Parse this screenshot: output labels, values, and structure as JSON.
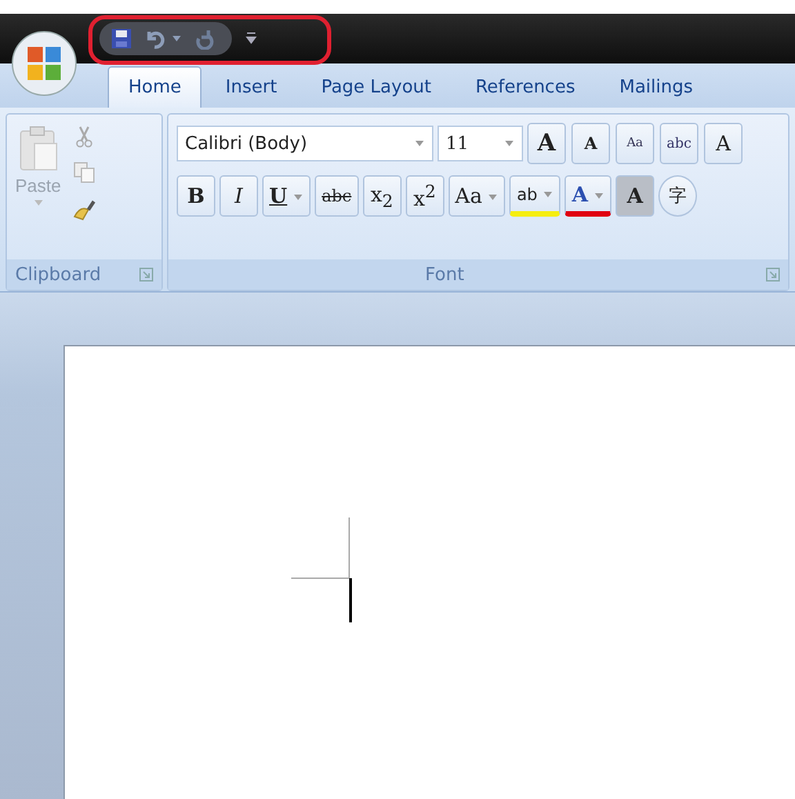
{
  "tabs": [
    {
      "label": "Home",
      "selected": true
    },
    {
      "label": "Insert",
      "selected": false
    },
    {
      "label": "Page Layout",
      "selected": false
    },
    {
      "label": "References",
      "selected": false
    },
    {
      "label": "Mailings",
      "selected": false
    }
  ],
  "clipboard": {
    "paste_label": "Paste",
    "group_label": "Clipboard"
  },
  "font": {
    "font_name": "Calibri (Body)",
    "font_size": "11",
    "group_label": "Font",
    "row_1": [
      {
        "kind": "grow",
        "text": "A"
      },
      {
        "kind": "shrink",
        "text": "A"
      },
      {
        "kind": "clear",
        "text": "Aa"
      },
      {
        "kind": "phonetic",
        "text": "abc"
      },
      {
        "kind": "border",
        "text": "A"
      }
    ],
    "row_2": [
      {
        "kind": "bold",
        "text": "B",
        "dropdown": false
      },
      {
        "kind": "italic",
        "text": "I",
        "dropdown": false
      },
      {
        "kind": "underline",
        "text": "U",
        "dropdown": true
      },
      {
        "kind": "strike",
        "text": "abc",
        "dropdown": false
      },
      {
        "kind": "plain",
        "text": "x$_{2}$",
        "dropdown": false
      },
      {
        "kind": "plain",
        "text": "x$^{2}$",
        "dropdown": false
      },
      {
        "kind": "plain",
        "text": "Aa",
        "dropdown": true
      },
      {
        "kind": "highlight",
        "text": "ab",
        "dropdown": true
      },
      {
        "kind": "fontcolor",
        "text": "A",
        "dropdown": true
      },
      {
        "kind": "shade",
        "text": "A",
        "dropdown": false
      },
      {
        "kind": "enclose",
        "text": "字",
        "dropdown": false
      }
    ]
  }
}
